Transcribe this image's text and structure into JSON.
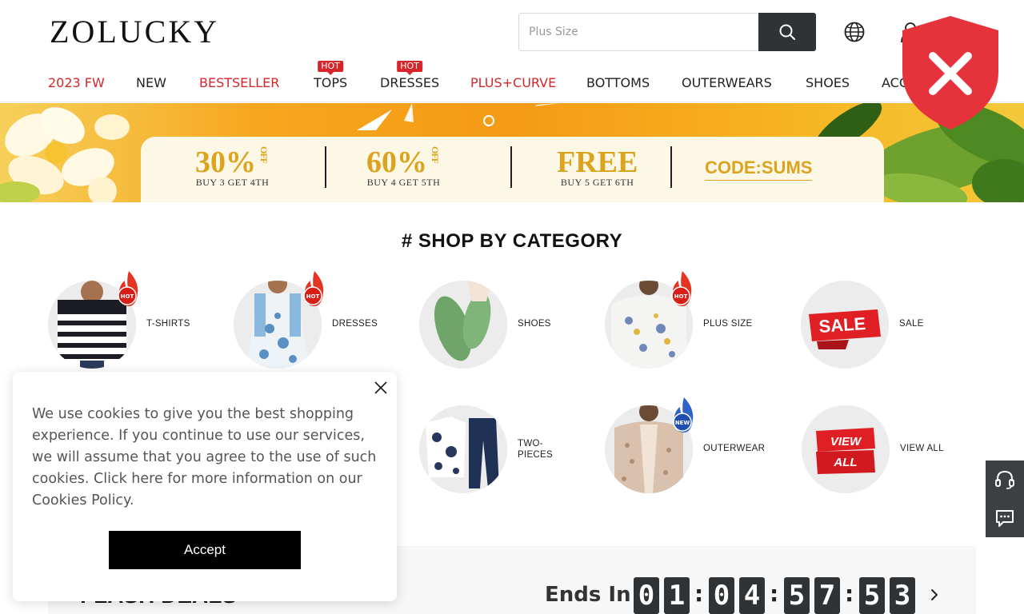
{
  "header": {
    "logo": "ZOLUCKY",
    "search_placeholder": "Plus Size"
  },
  "nav": {
    "items": [
      {
        "label": "2023 FW"
      },
      {
        "label": "NEW"
      },
      {
        "label": "BESTSELLER"
      },
      {
        "label": "TOPS",
        "badge": "HOT"
      },
      {
        "label": "DRESSES",
        "badge": "HOT"
      },
      {
        "label": "PLUS+CURVE"
      },
      {
        "label": "BOTTOMS"
      },
      {
        "label": "OUTERWEARS"
      },
      {
        "label": "SHOES"
      },
      {
        "label": "ACC"
      }
    ]
  },
  "banner": {
    "promos": [
      {
        "main": "30%",
        "off": "OFF",
        "sub": "BUY 3 GET 4TH"
      },
      {
        "main": "60%",
        "off": "OFF",
        "sub": "BUY 4 GET 5TH"
      },
      {
        "main": "FREE",
        "off": "",
        "sub": "BUY 5 GET 6TH"
      }
    ],
    "code": "CODE:SUMS"
  },
  "categories": {
    "title": "# SHOP BY CATEGORY",
    "items": [
      {
        "label": "T-SHIRTS",
        "badge": "HOT"
      },
      {
        "label": "DRESSES",
        "badge": "HOT"
      },
      {
        "label": "SHOES"
      },
      {
        "label": "PLUS SIZE",
        "badge": "HOT"
      },
      {
        "label": "SALE",
        "art": "SALE"
      },
      {
        "label": "TWO-\nPIECES"
      },
      {
        "label": "OUTERWEAR",
        "badge": "NEW"
      },
      {
        "label": "VIEW ALL",
        "art": "VIEW\nALL"
      }
    ]
  },
  "flash": {
    "title": "FLASH DEALS",
    "ends_label": "Ends In",
    "digits": [
      "0",
      "1",
      "0",
      "4",
      "5",
      "7",
      "5",
      "3"
    ]
  },
  "cookie": {
    "text": "We use cookies to give you the best shopping experience. If you continue to use our services, we will assume that you agree to the use of such cookies. Click here for more information on our Cookies Policy.",
    "accept_label": "Accept"
  },
  "colors": {
    "accent_red": "#d6262b",
    "dark": "#2f3336",
    "banner_gold": "#dba31e"
  }
}
